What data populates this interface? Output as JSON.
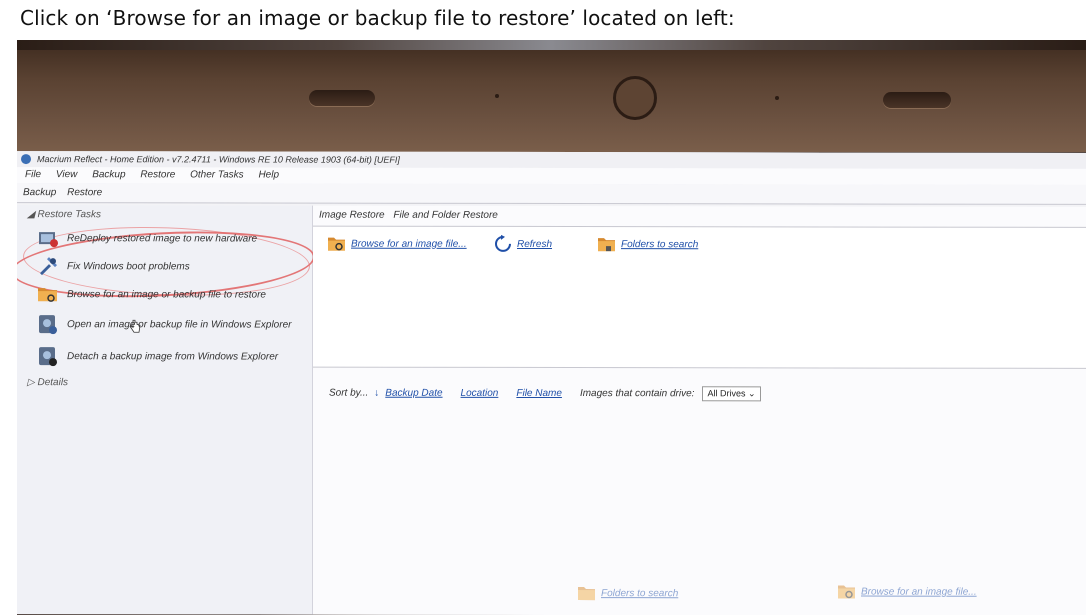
{
  "instruction": "Click on ‘Browse for an image or backup file to restore’ located on left:",
  "window": {
    "title": "Macrium Reflect - Home Edition - v7.2.4711 - Windows RE 10 Release 1903 (64-bit) [UEFI]",
    "menu": [
      "File",
      "View",
      "Backup",
      "Restore",
      "Other Tasks",
      "Help"
    ],
    "tabs": [
      "Backup",
      "Restore"
    ]
  },
  "left_pane": {
    "section_restore": "Restore Tasks",
    "tasks": [
      {
        "label": "ReDeploy restored image to new hardware",
        "icon": "redeploy-icon"
      },
      {
        "label": "Fix Windows boot problems",
        "icon": "tools-icon"
      },
      {
        "label": "Browse for an image or backup file to restore",
        "icon": "folder-search-icon"
      },
      {
        "label": "Open an image or backup file in Windows Explorer",
        "icon": "disk-open-icon"
      },
      {
        "label": "Detach a backup image from Windows Explorer",
        "icon": "disk-detach-icon"
      }
    ],
    "section_details": "Details"
  },
  "main_pane": {
    "subtabs": [
      "Image Restore",
      "File and Folder Restore"
    ],
    "toolbar": {
      "browse": "Browse for an image file...",
      "refresh": "Refresh",
      "folders": "Folders to search"
    },
    "sort": {
      "label": "Sort by...",
      "backup_date": "Backup Date",
      "location": "Location",
      "file_name": "File Name",
      "drive_label": "Images that contain drive:",
      "drive_value": "All Drives"
    },
    "bottom": {
      "folders": "Folders to search",
      "browse": "Browse for an image file..."
    }
  },
  "colors": {
    "link": "#1f4fa8",
    "annotation": "#e06060"
  }
}
